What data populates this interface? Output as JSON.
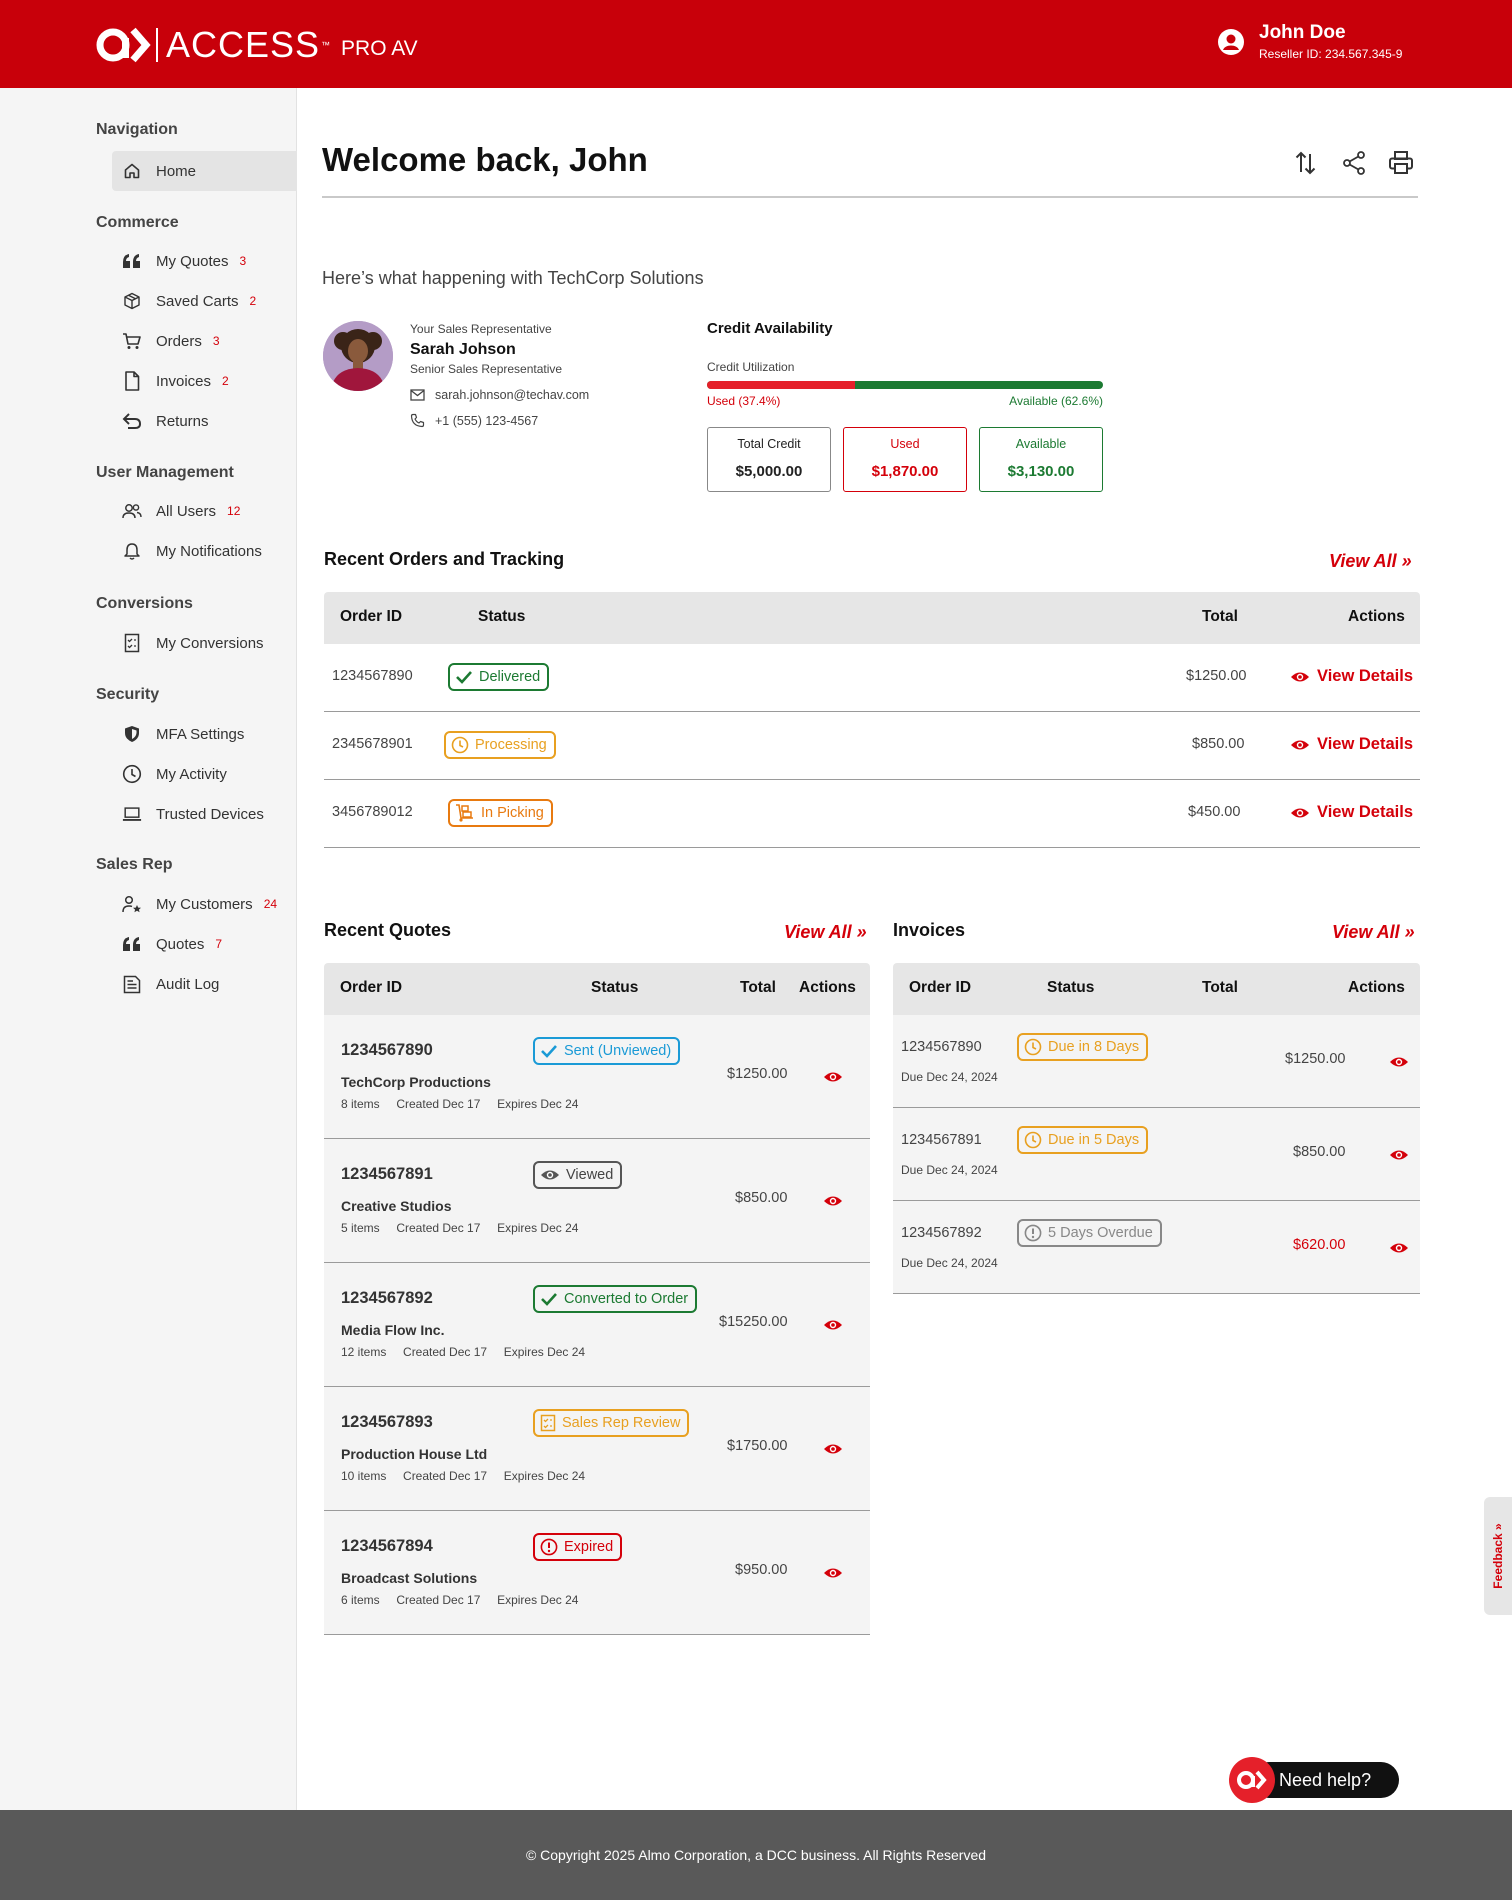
{
  "header": {
    "brand": "ACCESS",
    "brand_tm": "™",
    "brand_sub": "PRO AV",
    "user_name": "John Doe",
    "reseller_id": "Reseller ID: 234.567.345-9"
  },
  "sidebar": {
    "sections": [
      {
        "title": "Navigation"
      },
      {
        "title": "Commerce"
      },
      {
        "title": "User Management"
      },
      {
        "title": "Conversions"
      },
      {
        "title": "Security"
      },
      {
        "title": "Sales Rep"
      }
    ],
    "items": [
      {
        "label": "Home",
        "icon": "home-icon",
        "badge": ""
      },
      {
        "label": "My Quotes",
        "icon": "quote-icon",
        "badge": "3"
      },
      {
        "label": "Saved Carts",
        "icon": "box-icon",
        "badge": "2"
      },
      {
        "label": "Orders",
        "icon": "cart-icon",
        "badge": "3"
      },
      {
        "label": "Invoices",
        "icon": "document-icon",
        "badge": "2"
      },
      {
        "label": "Returns",
        "icon": "return-icon",
        "badge": ""
      },
      {
        "label": "All Users",
        "icon": "users-icon",
        "badge": "12"
      },
      {
        "label": "My Notifications",
        "icon": "bell-icon",
        "badge": ""
      },
      {
        "label": "My Conversions",
        "icon": "checklist-icon",
        "badge": ""
      },
      {
        "label": "MFA Settings",
        "icon": "shield-icon",
        "badge": ""
      },
      {
        "label": "My Activity",
        "icon": "clock-icon",
        "badge": ""
      },
      {
        "label": "Trusted Devices",
        "icon": "laptop-icon",
        "badge": ""
      },
      {
        "label": "My Customers",
        "icon": "user-star-icon",
        "badge": "24"
      },
      {
        "label": "Quotes",
        "icon": "quote-icon",
        "badge": "7"
      },
      {
        "label": "Audit Log",
        "icon": "log-icon",
        "badge": ""
      }
    ]
  },
  "main": {
    "title": "Welcome back, John",
    "subtitle": "Here’s what happening with TechCorp Solutions"
  },
  "rep": {
    "heading": "Your Sales Representative",
    "name": "Sarah Johson",
    "role": "Senior Sales Representative",
    "email": "sarah.johnson@techav.com",
    "phone": "+1 (555) 123-4567"
  },
  "credit": {
    "title": "Credit Availability",
    "utilization_label": "Credit Utilization",
    "used_fraction": 0.374,
    "used_label": "Used (37.4%)",
    "available_label": "Available (62.6%)",
    "boxes": [
      {
        "label": "Total Credit",
        "value": "$5,000.00",
        "color": "#111111"
      },
      {
        "label": "Used",
        "value": "$1,870.00",
        "color": "#d4000a"
      },
      {
        "label": "Available",
        "value": "$3,130.00",
        "color": "#1c7a32"
      }
    ]
  },
  "orders": {
    "title": "Recent Orders and Tracking",
    "view_all": "View All »",
    "headers": {
      "id": "Order ID",
      "status": "Status",
      "total": "Total",
      "actions": "Actions"
    },
    "action_label": "View Details",
    "rows": [
      {
        "id": "1234567890",
        "status": "Delivered",
        "total": "$1250.00"
      },
      {
        "id": "2345678901",
        "status": "Processing",
        "total": "$850.00"
      },
      {
        "id": "3456789012",
        "status": "In Picking",
        "total": "$450.00"
      }
    ]
  },
  "quotes": {
    "title": "Recent Quotes",
    "view_all": "View All »",
    "headers": {
      "id": "Order ID",
      "status": "Status",
      "total": "Total",
      "actions": "Actions"
    },
    "rows": [
      {
        "id": "1234567890",
        "status": "Sent (Unviewed)",
        "company": "TechCorp Productions",
        "meta": "8 items     Created Dec 17     Expires Dec 24",
        "total": "$1250.00"
      },
      {
        "id": "1234567891",
        "status": "Viewed",
        "company": "Creative Studios",
        "meta": "5 items     Created Dec 17     Expires Dec 24",
        "total": "$850.00"
      },
      {
        "id": "1234567892",
        "status": "Converted to Order",
        "company": "Media Flow Inc.",
        "meta": "12 items     Created Dec 17     Expires Dec 24",
        "total": "$15250.00"
      },
      {
        "id": "1234567893",
        "status": "Sales Rep Review",
        "company": "Production House Ltd",
        "meta": "10 items     Created Dec 17     Expires Dec 24",
        "total": "$1750.00"
      },
      {
        "id": "1234567894",
        "status": "Expired",
        "company": "Broadcast Solutions",
        "meta": "6 items     Created Dec 17     Expires Dec 24",
        "total": "$950.00"
      }
    ]
  },
  "invoices": {
    "title": "Invoices",
    "view_all": "View All »",
    "headers": {
      "id": "Order ID",
      "status": "Status",
      "total": "Total",
      "actions": "Actions"
    },
    "rows": [
      {
        "id": "1234567890",
        "status": "Due in 8 Days",
        "due": "Due Dec 24, 2024",
        "total": "$1250.00"
      },
      {
        "id": "1234567891",
        "status": "Due in 5 Days",
        "due": "Due Dec 24, 2024",
        "total": "$850.00"
      },
      {
        "id": "1234567892",
        "status": "5 Days Overdue",
        "due": "Due Dec 24, 2024",
        "total": "$620.00"
      }
    ]
  },
  "feedback": "Feedback »",
  "help": "Need help?",
  "footer": "© Copyright 2025 Almo Corporation, a DCC business. All Rights Reserved",
  "colors": {
    "brand": "#c8000a",
    "accent": "#d4000a",
    "success": "#1c7a32",
    "warning": "#e8a020",
    "orange": "#e87a10",
    "info": "#1a9ad6",
    "neutral": "#888888"
  }
}
